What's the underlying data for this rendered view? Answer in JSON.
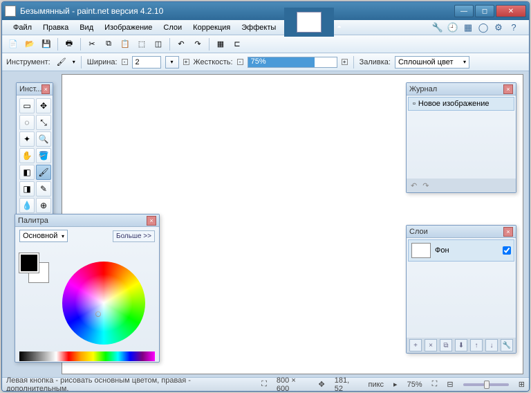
{
  "title": "Безымянный - paint.net версия 4.2.10",
  "menu": [
    "Файл",
    "Правка",
    "Вид",
    "Изображение",
    "Слои",
    "Коррекция",
    "Эффекты"
  ],
  "options": {
    "tool_label": "Инструмент:",
    "width_label": "Ширина:",
    "width_value": "2",
    "hardness_label": "Жесткость:",
    "hardness_value": "75%",
    "hardness_pct": 75,
    "fill_label": "Заливка:",
    "fill_value": "Сплошной цвет"
  },
  "panels": {
    "tools_title": "Инст...",
    "palette_title": "Палитра",
    "palette_mode": "Основной",
    "palette_more": "Больше >>",
    "history_title": "Журнал",
    "history_item": "Новое изображение",
    "layers_title": "Слои",
    "layer_name": "Фон"
  },
  "status": {
    "hint": "Левая кнопка - рисовать основным цветом, правая - дополнительным.",
    "size": "800 × 600",
    "pos": "181, 52",
    "unit": "пикс",
    "zoom": "75%"
  },
  "colors": {
    "accent": "#4a9ad8"
  }
}
